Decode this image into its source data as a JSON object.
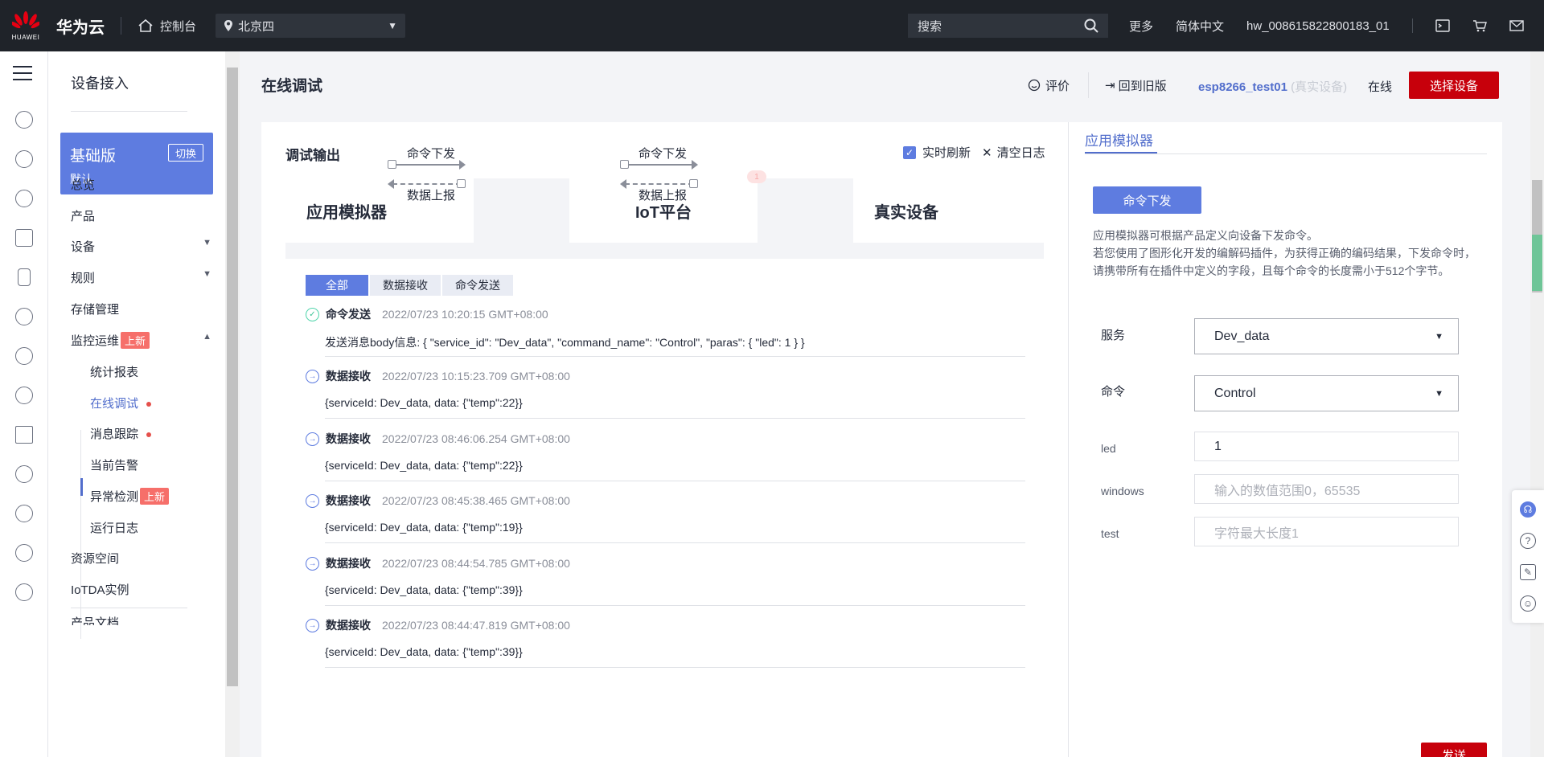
{
  "topbar": {
    "logo_text": "HUAWEI",
    "brand": "华为云",
    "console": "控制台",
    "region": "北京四",
    "search_placeholder": "搜索",
    "more": "更多",
    "language": "简体中文",
    "account": "hw_008615822800183_01"
  },
  "sidebar": {
    "title": "设备接入",
    "plan_name": "基础版",
    "plan_desc": "默认",
    "plan_switch": "切换",
    "items": [
      "总览",
      "产品",
      "设备",
      "规则",
      "存储管理",
      "监控运维",
      "资源空间",
      "IoTDA实例",
      "产品文档"
    ],
    "badge_new": "上新",
    "sub_items": [
      "统计报表",
      "在线调试",
      "消息跟踪",
      "当前告警",
      "异常检测",
      "运行日志"
    ]
  },
  "header": {
    "title": "在线调试",
    "rate": "评价",
    "back_old": "回到旧版",
    "device_name": "esp8266_test01",
    "device_type": "(真实设备)",
    "status": "在线",
    "pick_device": "选择设备"
  },
  "debug": {
    "title": "调试输出",
    "realtime_refresh": "实时刷新",
    "clear_log": "清空日志",
    "flow": {
      "app_sim": "应用模拟器",
      "iot_platform": "IoT平台",
      "real_device": "真实设备",
      "cmd_down": "命令下发",
      "data_up": "数据上报"
    },
    "tabs": [
      "全部",
      "数据接收",
      "命令发送"
    ],
    "logs": [
      {
        "type": "命令发送",
        "time": "2022/07/23 10:20:15 GMT+08:00",
        "body": "发送消息body信息: { \"service_id\": \"Dev_data\", \"command_name\": \"Control\", \"paras\": { \"led\": 1 } }"
      },
      {
        "type": "数据接收",
        "time": "2022/07/23 10:15:23.709 GMT+08:00",
        "body": "{serviceId: Dev_data, data: {\"temp\":22}}"
      },
      {
        "type": "数据接收",
        "time": "2022/07/23 08:46:06.254 GMT+08:00",
        "body": "{serviceId: Dev_data, data: {\"temp\":22}}"
      },
      {
        "type": "数据接收",
        "time": "2022/07/23 08:45:38.465 GMT+08:00",
        "body": "{serviceId: Dev_data, data: {\"temp\":19}}"
      },
      {
        "type": "数据接收",
        "time": "2022/07/23 08:44:54.785 GMT+08:00",
        "body": "{serviceId: Dev_data, data: {\"temp\":39}}"
      },
      {
        "type": "数据接收",
        "time": "2022/07/23 08:44:47.819 GMT+08:00",
        "body": "{serviceId: Dev_data, data: {\"temp\":39}}"
      }
    ]
  },
  "simulator": {
    "tab": "应用模拟器",
    "cmd_button": "命令下发",
    "desc1": "应用模拟器可根据产品定义向设备下发命令。",
    "desc2": "若您使用了图形化开发的编解码插件，为获得正确的编码结果，下发命令时，请携带所有在插件中定义的字段，且每个命令的长度需小于512个字节。",
    "service_label": "服务",
    "service_value": "Dev_data",
    "command_label": "命令",
    "command_value": "Control",
    "led_label": "led",
    "led_value": "1",
    "windows_label": "windows",
    "windows_placeholder": "输入的数值范围0，65535",
    "test_label": "test",
    "test_placeholder": "字符最大长度1",
    "send": "发送"
  },
  "colors": {
    "brand_red": "#c7000b",
    "accent_blue": "#5e7ce0"
  }
}
